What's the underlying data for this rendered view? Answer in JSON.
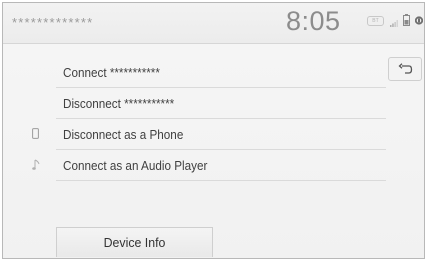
{
  "status_bar": {
    "device_name": "*************",
    "clock": "8:05",
    "bluetooth_badge_text": "BT"
  },
  "menu": {
    "items": [
      {
        "label": "Connect ***********",
        "icon": null
      },
      {
        "label": "Disconnect ***********",
        "icon": null
      },
      {
        "label": "Disconnect as a Phone",
        "icon": "phone-icon"
      },
      {
        "label": "Connect as an Audio Player",
        "icon": "music-note-icon"
      }
    ]
  },
  "back_button": {
    "icon": "back-arrow-icon"
  },
  "device_info_button": {
    "label": "Device Info"
  },
  "colors": {
    "background": "#f3f3f3",
    "text": "#404040",
    "muted": "#9a9a9a",
    "divider": "#dadada"
  }
}
